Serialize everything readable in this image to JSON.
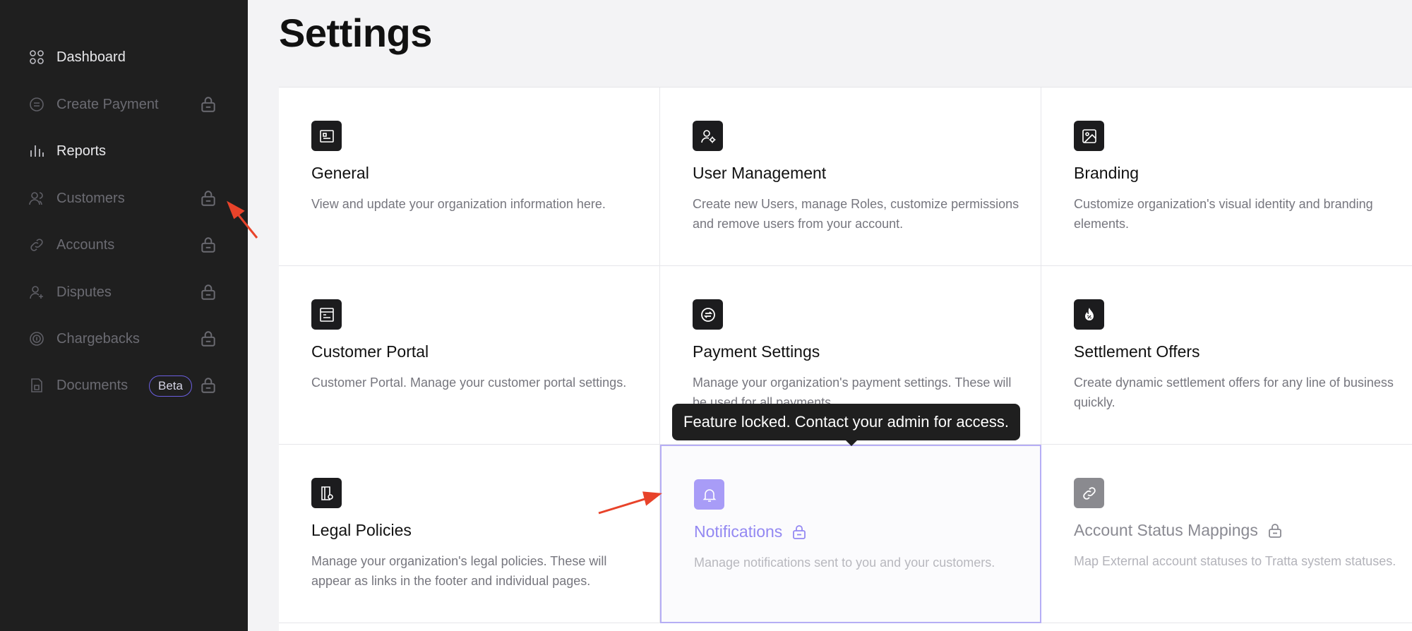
{
  "sidebar": {
    "items": [
      {
        "label": "Dashboard",
        "icon": "grid-icon",
        "locked": false
      },
      {
        "label": "Create Payment",
        "icon": "payment-icon",
        "locked": true
      },
      {
        "label": "Reports",
        "icon": "bar-chart-icon",
        "locked": false
      },
      {
        "label": "Customers",
        "icon": "users-icon",
        "locked": true
      },
      {
        "label": "Accounts",
        "icon": "link-icon",
        "locked": true
      },
      {
        "label": "Disputes",
        "icon": "user-plus-icon",
        "locked": true
      },
      {
        "label": "Chargebacks",
        "icon": "coin-icon",
        "locked": true
      },
      {
        "label": "Documents",
        "icon": "document-icon",
        "locked": true,
        "badge": "Beta"
      }
    ]
  },
  "main": {
    "title": "Settings",
    "cards": [
      {
        "title": "General",
        "icon": "id-card-icon",
        "description": "View and update your organization information here."
      },
      {
        "title": "User Management",
        "icon": "user-gear-icon",
        "description": "Create new Users, manage Roles, customize permissions and remove users from your account."
      },
      {
        "title": "Branding",
        "icon": "image-icon",
        "description": "Customize organization's visual identity and branding elements."
      },
      {
        "title": "Customer Portal",
        "icon": "browser-icon",
        "description": "Customer Portal. Manage your customer portal settings."
      },
      {
        "title": "Payment Settings",
        "icon": "exchange-icon",
        "description": "Manage your organization's payment settings. These will be used for all payments."
      },
      {
        "title": "Settlement Offers",
        "icon": "percent-flame-icon",
        "description": "Create dynamic settlement offers for any line of business quickly."
      },
      {
        "title": "Legal Policies",
        "icon": "policy-doc-icon",
        "description": "Manage your organization's legal policies. These will appear as links in the footer and individual pages."
      },
      {
        "title": "Notifications",
        "icon": "bell-icon",
        "description": "Manage notifications sent to you and your customers.",
        "locked": true
      },
      {
        "title": "Account Status Mappings",
        "icon": "link-icon",
        "description": "Map External account statuses to Tratta system statuses.",
        "locked": true
      }
    ]
  },
  "tooltip": {
    "text": "Feature locked. Contact your admin for access."
  },
  "colors": {
    "sidebar_bg": "#1f1f1f",
    "accent": "#a89cf7",
    "annotation_arrow": "#e8432a"
  }
}
